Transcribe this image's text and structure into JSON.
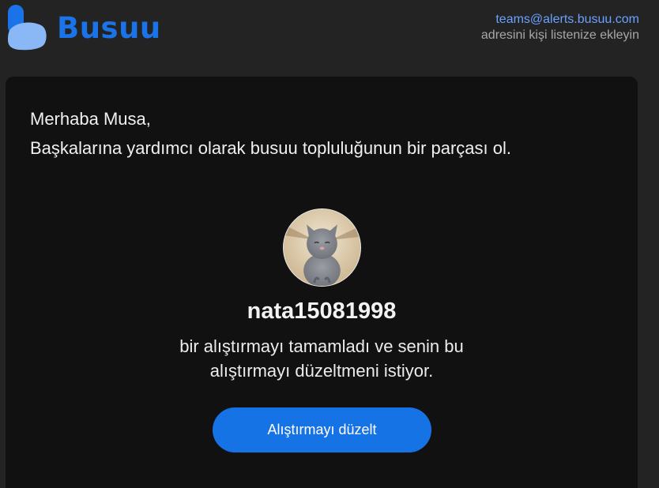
{
  "brand": {
    "logo_icon": "busuu-logo-icon",
    "name": "Busuu",
    "color": "#1a73e8"
  },
  "header": {
    "sender_email": "teams@alerts.busuu.com",
    "sender_note": "adresini kişi listenize ekleyin"
  },
  "email": {
    "greeting": "Merhaba Musa,",
    "intro": "Başkalarına yardımcı olarak busuu topluluğunun bir parçası ol.",
    "avatar_icon": "user-avatar-cat",
    "username": "nata15081998",
    "message": "bir alıştırmayı tamamladı ve senin bu alıştırmayı düzeltmeni istiyor.",
    "cta_label": "Alıştırmayı düzelt",
    "cta_color": "#1673e6"
  }
}
